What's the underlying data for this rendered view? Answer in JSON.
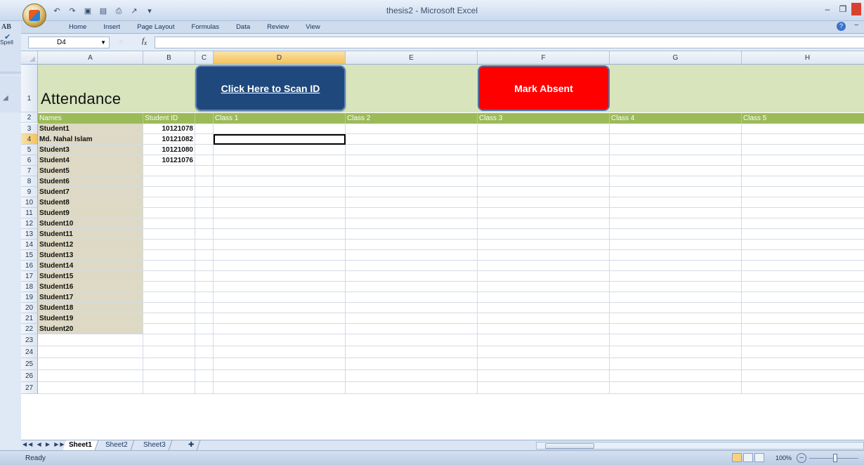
{
  "window": {
    "title": "thesis2 - Microsoft Excel"
  },
  "ribbon": {
    "tabs": [
      "Home",
      "Insert",
      "Page Layout",
      "Formulas",
      "Data",
      "Review",
      "View"
    ],
    "left_label": "AB",
    "spell_label": "Spell"
  },
  "formula_bar": {
    "name_box": "D4",
    "fx": "fx",
    "value": ""
  },
  "columns": [
    "A",
    "B",
    "C",
    "D",
    "E",
    "F",
    "G",
    "H"
  ],
  "sheet": {
    "title": "Attendance",
    "scan_button": "Click Here to Scan ID",
    "absent_button": "Mark Absent",
    "headers": [
      "Names",
      "Student ID",
      "",
      "Class 1",
      "Class 2",
      "Class 3",
      "Class 4",
      "Class 5"
    ],
    "rows": [
      {
        "n": "3",
        "name": "Student1",
        "id": "10121078"
      },
      {
        "n": "4",
        "name": "Md. Nahal Islam",
        "id": "10121082"
      },
      {
        "n": "5",
        "name": "Student3",
        "id": "10121080"
      },
      {
        "n": "6",
        "name": "Student4",
        "id": "10121076"
      },
      {
        "n": "7",
        "name": "Student5",
        "id": ""
      },
      {
        "n": "8",
        "name": "Student6",
        "id": ""
      },
      {
        "n": "9",
        "name": "Student7",
        "id": ""
      },
      {
        "n": "10",
        "name": "Student8",
        "id": ""
      },
      {
        "n": "11",
        "name": "Student9",
        "id": ""
      },
      {
        "n": "12",
        "name": "Student10",
        "id": ""
      },
      {
        "n": "13",
        "name": "Student11",
        "id": ""
      },
      {
        "n": "14",
        "name": "Student12",
        "id": ""
      },
      {
        "n": "15",
        "name": "Student13",
        "id": ""
      },
      {
        "n": "16",
        "name": "Student14",
        "id": ""
      },
      {
        "n": "17",
        "name": "Student15",
        "id": ""
      },
      {
        "n": "18",
        "name": "Student16",
        "id": ""
      },
      {
        "n": "19",
        "name": "Student17",
        "id": ""
      },
      {
        "n": "20",
        "name": "Student18",
        "id": ""
      },
      {
        "n": "21",
        "name": "Student19",
        "id": ""
      },
      {
        "n": "22",
        "name": "Student20",
        "id": ""
      }
    ],
    "empty_rows": [
      "23",
      "24",
      "25",
      "26",
      "27"
    ],
    "row1": "1",
    "row2": "2"
  },
  "sheet_tabs": [
    "Sheet1",
    "Sheet2",
    "Sheet3"
  ],
  "status": {
    "text": "Ready",
    "zoom": "100%"
  },
  "colors": {
    "band": "#d7e4bc",
    "subheader": "#9bbb59",
    "scan_button": "#1f497d",
    "absent_button": "#ff0000",
    "name_fill": "#ddd9c4"
  }
}
